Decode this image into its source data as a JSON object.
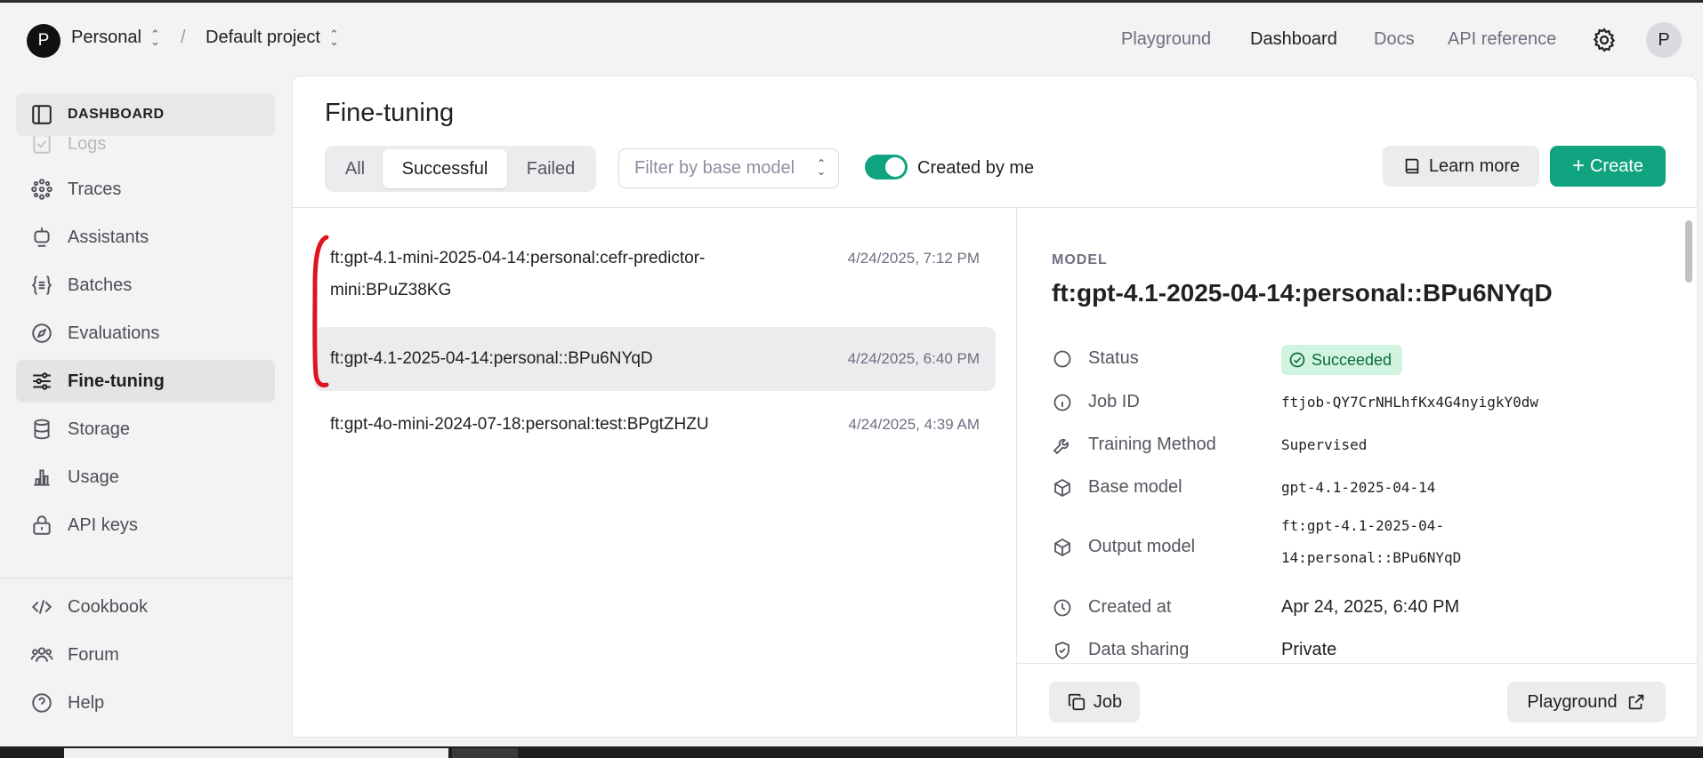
{
  "topbar": {
    "org_initial": "P",
    "org_name": "Personal",
    "project_name": "Default project",
    "nav": [
      "Playground",
      "Dashboard",
      "Docs",
      "API reference"
    ],
    "active_nav": "Dashboard",
    "user_initial": "P"
  },
  "sidebar": {
    "header": "DASHBOARD",
    "items": [
      {
        "label": "Logs",
        "icon": "logs-icon"
      },
      {
        "label": "Traces",
        "icon": "traces-icon"
      },
      {
        "label": "Assistants",
        "icon": "assistants-icon"
      },
      {
        "label": "Batches",
        "icon": "batches-icon"
      },
      {
        "label": "Evaluations",
        "icon": "evaluations-icon"
      },
      {
        "label": "Fine-tuning",
        "icon": "fine-tuning-icon"
      },
      {
        "label": "Storage",
        "icon": "storage-icon"
      },
      {
        "label": "Usage",
        "icon": "usage-icon"
      },
      {
        "label": "API keys",
        "icon": "api-keys-icon"
      }
    ],
    "footer_items": [
      {
        "label": "Cookbook",
        "icon": "code-icon"
      },
      {
        "label": "Forum",
        "icon": "forum-icon"
      },
      {
        "label": "Help",
        "icon": "help-icon"
      }
    ],
    "active_item": "Fine-tuning"
  },
  "main": {
    "title": "Fine-tuning",
    "segments": [
      "All",
      "Successful",
      "Failed"
    ],
    "active_segment": "Successful",
    "filter_placeholder": "Filter by base model",
    "toggle_label": "Created by me",
    "toggle_on": true,
    "learn_more": "Learn more",
    "create": "Create",
    "jobs": [
      {
        "name": "ft:gpt-4.1-mini-2025-04-14:personal:cefr-predictor-mini:BPuZ38KG",
        "date": "4/24/2025, 7:12 PM"
      },
      {
        "name": "ft:gpt-4.1-2025-04-14:personal::BPu6NYqD",
        "date": "4/24/2025, 6:40 PM"
      },
      {
        "name": "ft:gpt-4o-mini-2024-07-18:personal:test:BPgtZHZU",
        "date": "4/24/2025, 4:39 AM"
      }
    ],
    "selected_job_index": 1
  },
  "detail": {
    "label": "MODEL",
    "title": "ft:gpt-4.1-2025-04-14:personal::BPu6NYqD",
    "props": {
      "status_key": "Status",
      "status_val": "Succeeded",
      "job_id_key": "Job ID",
      "job_id_val": "ftjob-QY7CrNHLhfKx4G4nyigkY0dw",
      "method_key": "Training Method",
      "method_val": "Supervised",
      "base_key": "Base model",
      "base_val": "gpt-4.1-2025-04-14",
      "output_key": "Output model",
      "output_val_1": "ft:gpt-4.1-2025-04-",
      "output_val_2": "14:personal::BPu6NYqD",
      "created_key": "Created at",
      "created_val": "Apr 24, 2025, 6:40 PM",
      "sharing_key": "Data sharing",
      "sharing_val": "Private"
    },
    "job_button": "Job",
    "playground_button": "Playground"
  },
  "colors": {
    "accent": "#10a37f",
    "annotation": "#e0141e",
    "success_bg": "#d1f4e0"
  }
}
